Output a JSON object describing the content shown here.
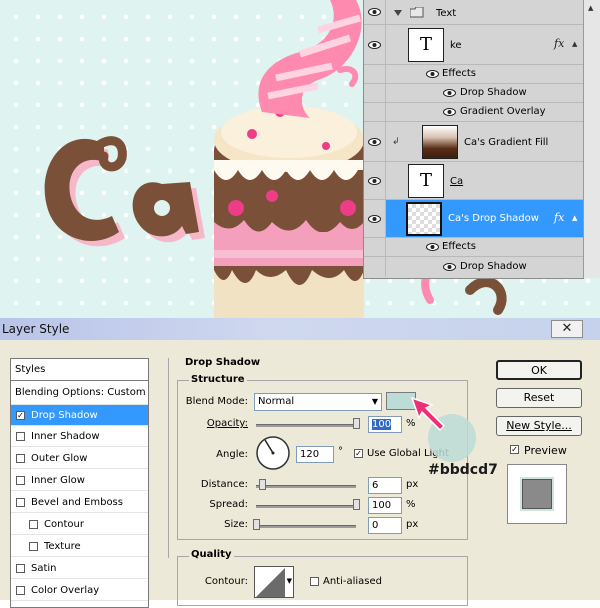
{
  "colors": {
    "canvas_bg": "#dff3f0",
    "chocolate": "#7a5038",
    "pink": "#ff8ab0",
    "selection": "#3399ff",
    "shadow_swatch": "#bbdcd7",
    "annotation_arrow": "#ee2e76"
  },
  "layers": {
    "group": {
      "name": "Text",
      "icons": [
        "eye-icon",
        "folder-icon",
        "collapse-arrow-icon"
      ]
    },
    "rows": [
      {
        "name": "ke",
        "thumbnail": "T",
        "has_fx": true
      },
      {
        "name": "Effects"
      },
      {
        "name": "Drop Shadow"
      },
      {
        "name": "Gradient Overlay"
      },
      {
        "name": "Ca's Gradient Fill"
      },
      {
        "name": "Ca",
        "thumbnail": "T"
      },
      {
        "name": "Ca's Drop Shadow",
        "selected": true,
        "has_fx": true
      },
      {
        "name": "Effects"
      },
      {
        "name": "Drop Shadow"
      }
    ],
    "fx_label": "fx"
  },
  "dialog": {
    "title": "Layer Style",
    "close_icon": "✕",
    "styles_header": "Styles",
    "style_items": [
      {
        "label": "Blending Options: Custom",
        "checkbox": false
      },
      {
        "label": "Drop Shadow",
        "checked": true,
        "selected": true
      },
      {
        "label": "Inner Shadow",
        "checked": false
      },
      {
        "label": "Outer Glow",
        "checked": false
      },
      {
        "label": "Inner Glow",
        "checked": false
      },
      {
        "label": "Bevel and Emboss",
        "checked": false
      },
      {
        "label": "Contour",
        "checked": false
      },
      {
        "label": "Texture",
        "checked": false
      },
      {
        "label": "Satin",
        "checked": false
      },
      {
        "label": "Color Overlay",
        "checked": false
      }
    ],
    "section_title": "Drop Shadow",
    "structure": {
      "legend": "Structure",
      "blend_mode_label": "Blend Mode:",
      "blend_mode_value": "Normal",
      "opacity_label": "Opacity:",
      "opacity_value": "100",
      "opacity_level": 100,
      "angle_label": "Angle:",
      "angle_value": "120",
      "degree_symbol": "°",
      "global_light_label": "Use Global Light",
      "global_light_checked": true,
      "distance_label": "Distance:",
      "distance_value": "6",
      "distance_level": 6,
      "spread_label": "Spread:",
      "spread_value": "100",
      "spread_level": 100,
      "size_label": "Size:",
      "size_value": "0",
      "size_level": 0,
      "unit_px": "px",
      "unit_pct": "%"
    },
    "quality": {
      "legend": "Quality",
      "contour_label": "Contour:",
      "antialiased_label": "Anti-aliased",
      "antialiased_checked": false
    },
    "buttons": {
      "ok": "OK",
      "reset": "Reset",
      "new_style": "New Style...",
      "preview": "Preview",
      "preview_checked": true
    },
    "annotation_hex": "#bbdcd7"
  }
}
